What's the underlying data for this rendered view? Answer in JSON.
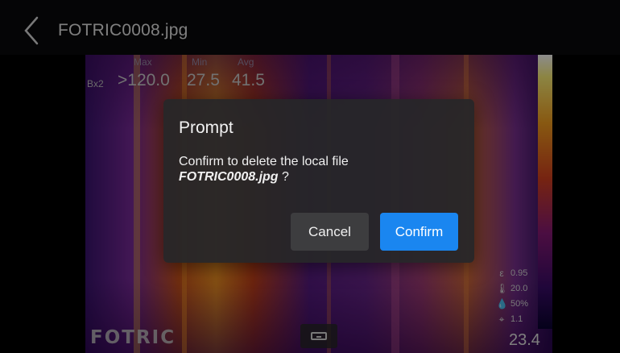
{
  "header": {
    "file_name": "FOTRIC0008.jpg"
  },
  "stats": {
    "labels": {
      "max": "Max",
      "min": "Min",
      "avg": "Avg"
    },
    "row_label": "Bx2",
    "max_value": ">120.0",
    "min_value": "27.5",
    "avg_value": "41.5"
  },
  "parameters": {
    "emissivity": "0.95",
    "reflected_temp": "20.0",
    "humidity": "50%",
    "distance": "1.1"
  },
  "crosshair_temp": "23.4",
  "brand_logo": "FOTRIC",
  "dialog": {
    "title": "Prompt",
    "message": "Confirm to delete the local file",
    "file": "FOTRIC0008.jpg",
    "suffix": " ?",
    "cancel_label": "Cancel",
    "confirm_label": "Confirm"
  },
  "colors": {
    "confirm": "#1a86f0",
    "dialog_bg": "#262628"
  }
}
